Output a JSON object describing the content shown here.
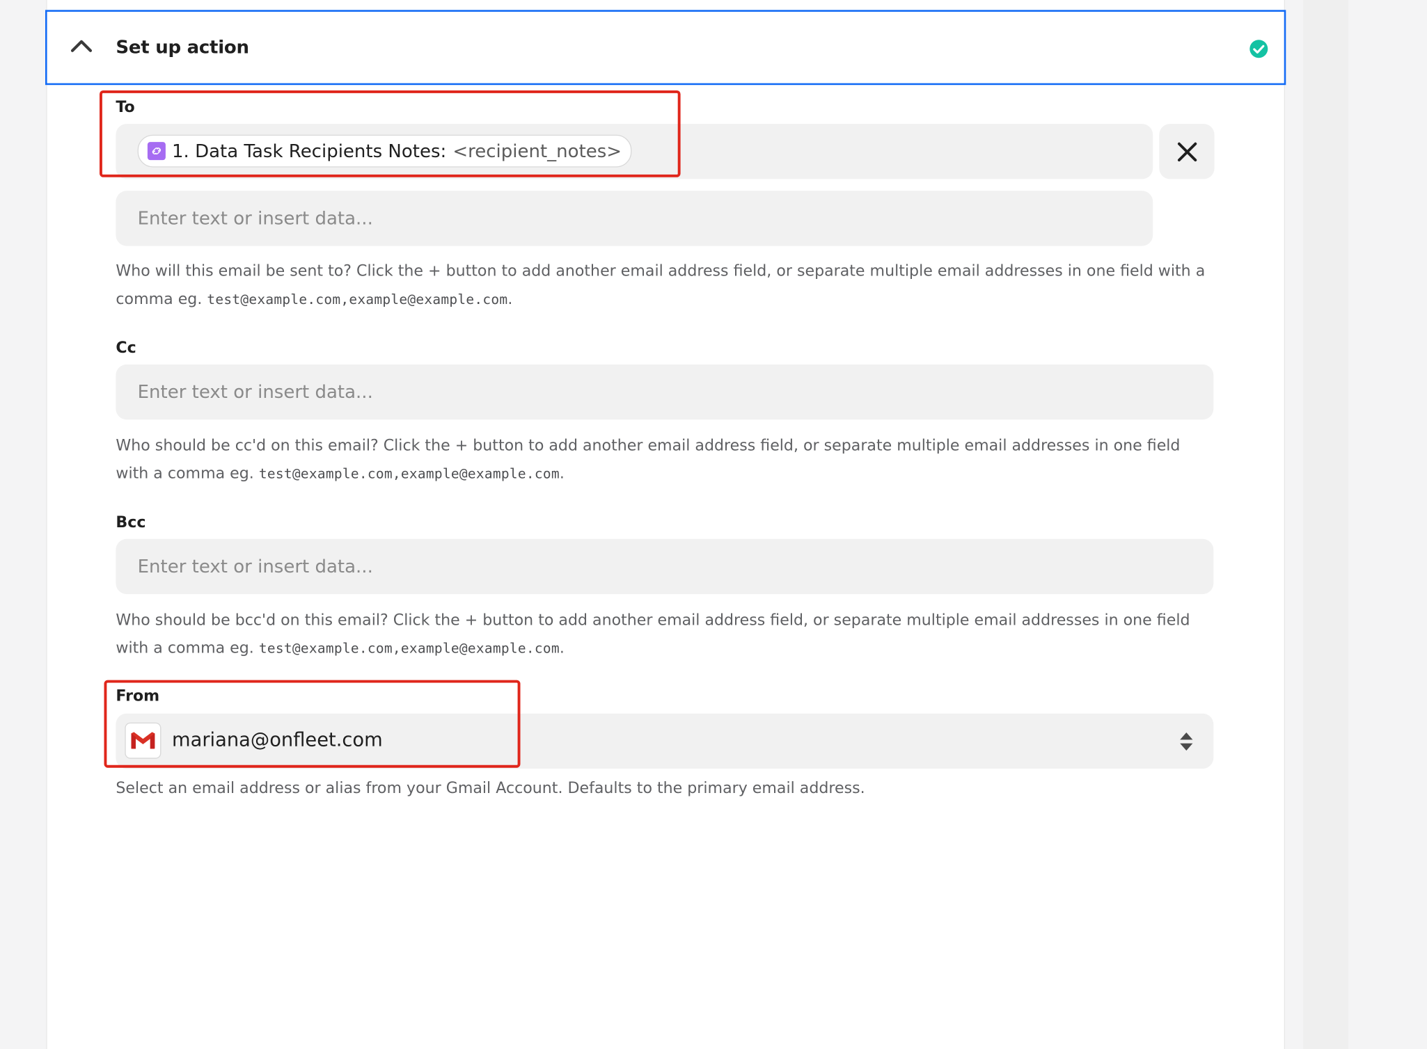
{
  "header": {
    "title": "Set up action"
  },
  "fields": {
    "to": {
      "label": "To",
      "pill_title": "1. Data Task Recipients Notes:",
      "pill_value": "<recipient_notes>",
      "extra_placeholder": "Enter text or insert data...",
      "help_text": "Who will this email be sent to? Click the + button to add another email address field, or separate multiple email addresses in one field with a comma eg.",
      "help_example": "test@example.com,example@example.com",
      "help_end": "."
    },
    "cc": {
      "label": "Cc",
      "placeholder": "Enter text or insert data...",
      "help_text": "Who should be cc'd on this email? Click the + button to add another email address field, or separate multiple email addresses in one field with a comma eg.",
      "help_example": "test@example.com,example@example.com",
      "help_end": "."
    },
    "bcc": {
      "label": "Bcc",
      "placeholder": "Enter text or insert data...",
      "help_text": "Who should be bcc'd on this email? Click the + button to add another email address field, or separate multiple email addresses in one field with a comma eg.",
      "help_example": "test@example.com,example@example.com",
      "help_end": "."
    },
    "from": {
      "label": "From",
      "value": "mariana@onfleet.com",
      "help_text": "Select an email address or alias from your Gmail Account. Defaults to the primary email address."
    }
  },
  "colors": {
    "accent_border": "#136bf5",
    "success": "#14c2a3",
    "highlight": "#e0261b",
    "pill_icon": "#a66cf2",
    "gmail_red": "#d93025"
  },
  "icons": {
    "collapse": "chevron-up-icon",
    "status": "check-circle-icon",
    "clear": "close-icon",
    "pill": "data-link-icon",
    "from_account": "gmail-icon",
    "select": "sort-arrows-icon"
  }
}
